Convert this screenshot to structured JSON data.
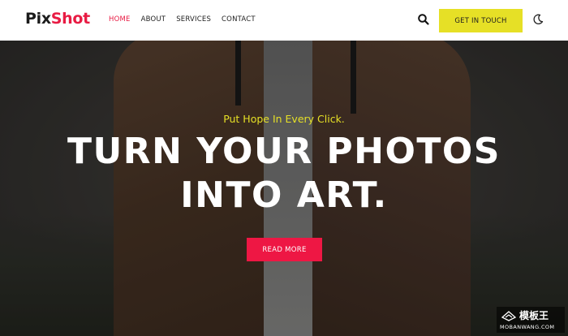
{
  "header": {
    "logo": {
      "part1": "Pix",
      "part2": "Shot"
    },
    "nav": [
      {
        "label": "HOME",
        "active": true
      },
      {
        "label": "ABOUT",
        "active": false
      },
      {
        "label": "SERVICES",
        "active": false
      },
      {
        "label": "CONTACT",
        "active": false
      }
    ],
    "search_icon": "search-icon",
    "cta_label": "GET IN TOUCH",
    "theme_icon": "moon-icon"
  },
  "hero": {
    "tagline": "Put Hope In Every Click.",
    "headline_line1": "TURN YOUR PHOTOS",
    "headline_line2": "INTO ART.",
    "button_label": "READ MORE"
  },
  "watermark": {
    "title": "模板王",
    "url": "MOBANWANG.COM"
  },
  "colors": {
    "brand_red": "#e81b43",
    "accent_yellow": "#e6e026",
    "button_red": "#ee1744"
  }
}
